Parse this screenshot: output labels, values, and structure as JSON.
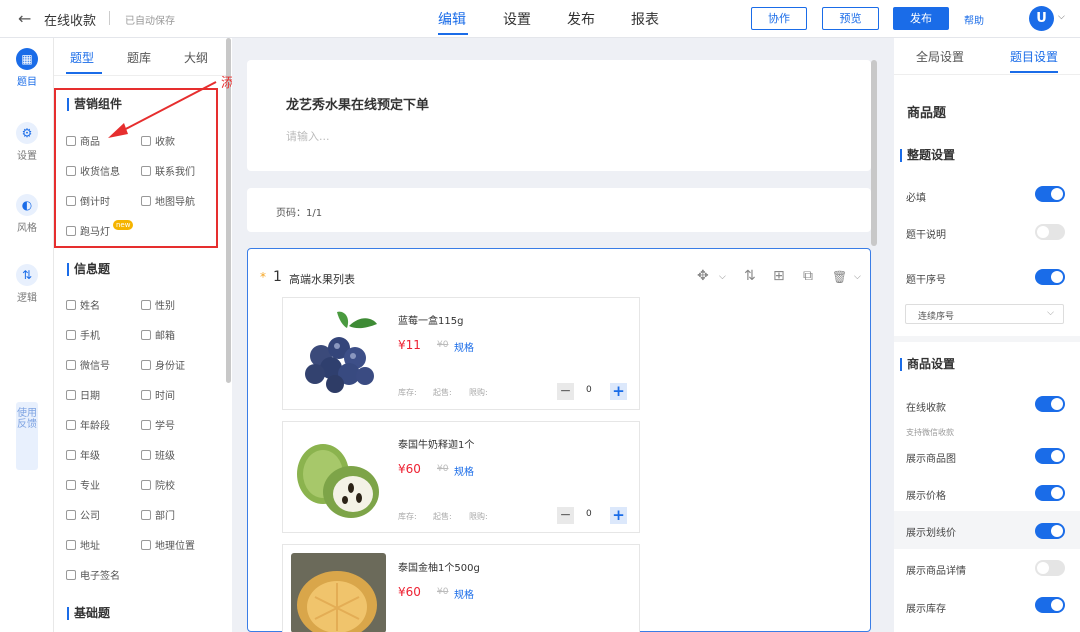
{
  "header": {
    "back_icon": "←",
    "title": "在线收款",
    "autosave": "已自动保存",
    "tabs": [
      "编辑",
      "设置",
      "发布",
      "报表"
    ],
    "collab": "协作",
    "preview": "预览",
    "publish": "发布",
    "help": "帮助",
    "avatar": "U",
    "caret": "⌵"
  },
  "rail": {
    "items": [
      {
        "label": "题目",
        "icon": "▦"
      },
      {
        "label": "设置",
        "icon": "⚙"
      },
      {
        "label": "风格",
        "icon": "◐"
      },
      {
        "label": "逻辑",
        "icon": "⇅"
      }
    ],
    "feedback": "使用反馈"
  },
  "components": {
    "tabs": [
      "题型",
      "题库",
      "大纲"
    ],
    "sections": [
      {
        "title": "营销组件",
        "items": [
          "商品",
          "收款",
          "收货信息",
          "联系我们",
          "倒计时",
          "地图导航",
          "跑马灯"
        ]
      },
      {
        "title": "信息题",
        "items": [
          "姓名",
          "性别",
          "手机",
          "邮箱",
          "微信号",
          "身份证",
          "日期",
          "时间",
          "年龄段",
          "学号",
          "年级",
          "班级",
          "专业",
          "院校",
          "公司",
          "部门",
          "地址",
          "地理位置",
          "电子签名"
        ]
      },
      {
        "title": "基础题",
        "items": []
      }
    ],
    "new_badge": "new",
    "annotation": "添加商品"
  },
  "form": {
    "title": "龙艺秀水果在线预定下单",
    "desc_placeholder": "请输入...",
    "page_info": "页码：1/1",
    "question": {
      "required_mark": "*",
      "number": "1",
      "title": "高端水果列表",
      "tools": [
        "✥",
        "⌵",
        "⇅",
        "⊞",
        "⧉",
        "🗑",
        "⌵"
      ]
    },
    "products": [
      {
        "name": "蓝莓一盒115g",
        "price": "¥11",
        "orig": "¥0",
        "spec": "规格",
        "stock": "库存:",
        "min": "起售:",
        "limit": "限购:",
        "qty": "0",
        "minus": "−",
        "plus": "+"
      },
      {
        "name": "泰国牛奶释迦1个",
        "price": "¥60",
        "orig": "¥0",
        "spec": "规格",
        "stock": "库存:",
        "min": "起售:",
        "limit": "限购:",
        "qty": "0",
        "minus": "−",
        "plus": "+"
      },
      {
        "name": "泰国金柚1个500g",
        "price": "¥60",
        "orig": "¥0",
        "spec": "规格"
      }
    ]
  },
  "settings": {
    "tabs": [
      "全局设置",
      "题目设置"
    ],
    "heading": "商品题",
    "section1": "整题设置",
    "section2": "商品设置",
    "required": "必填",
    "desc": "题干说明",
    "seq": "题干序号",
    "seq_value": "连续序号",
    "seq_caret": "⌵",
    "online_pay": "在线收款",
    "wechat": "支持微信收款",
    "show_img": "展示商品图",
    "show_price": "展示价格",
    "show_strike": "展示划线价",
    "show_detail": "展示商品详情",
    "show_stock": "展示库存",
    "toggle_states": {
      "required": true,
      "desc": false,
      "seq": true,
      "online_pay": true,
      "show_img": true,
      "show_price": true,
      "show_strike": true,
      "show_detail": false,
      "show_stock": true
    }
  }
}
